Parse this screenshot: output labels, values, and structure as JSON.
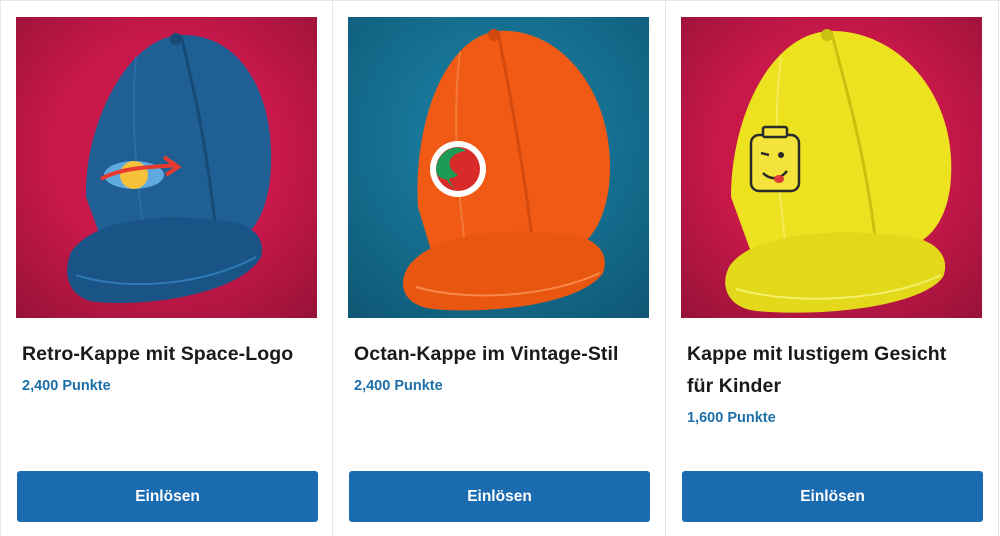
{
  "products": [
    {
      "title": "Retro-Kappe mit Space-Logo",
      "points": "2,400 Punkte",
      "button_label": "Einlösen",
      "image_background": "#c8184a",
      "cap_color": "#1f5f94"
    },
    {
      "title": "Octan-Kappe im Vintage-Stil",
      "points": "2,400 Punkte",
      "button_label": "Einlösen",
      "image_background": "#156e8f",
      "cap_color": "#f05a14"
    },
    {
      "title": "Kappe mit lustigem Gesicht für Kinder",
      "points": "1,600 Punkte",
      "button_label": "Einlösen",
      "image_background": "#c8184a",
      "cap_color": "#ece21f"
    }
  ],
  "colors": {
    "accent_button": "#1b6bb1",
    "points_text": "#1d6fa8"
  }
}
